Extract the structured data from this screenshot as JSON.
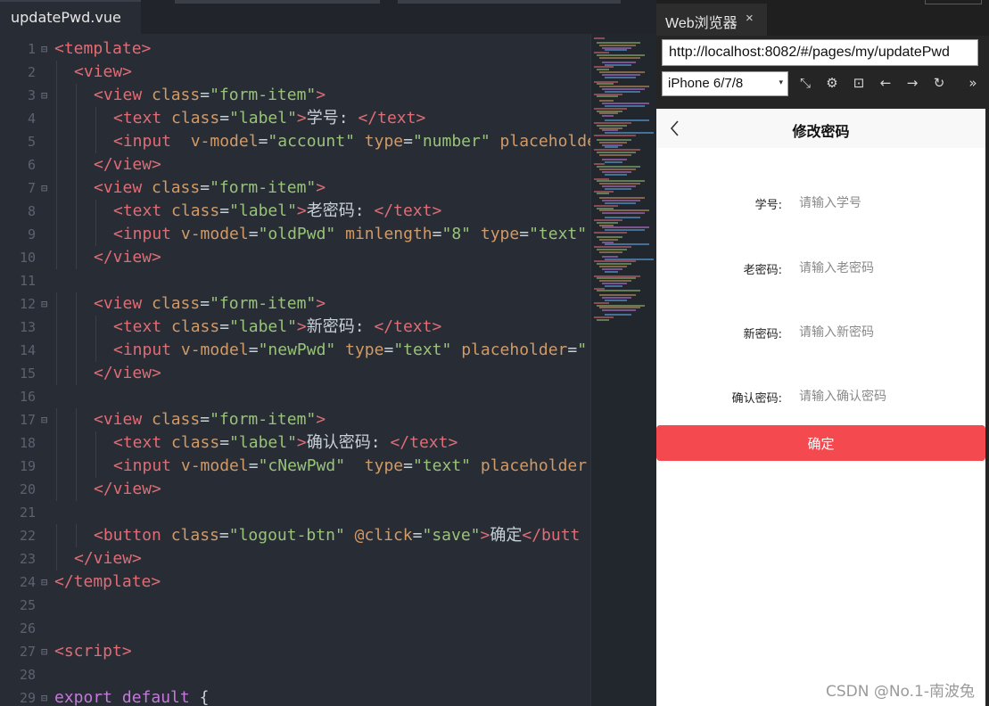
{
  "editor": {
    "tab_title": "updatePwd.vue",
    "lines": [
      {
        "n": "1",
        "fold": "⊟",
        "indent": 0,
        "tokens": [
          [
            "t-tag",
            "<template>"
          ]
        ]
      },
      {
        "n": "2",
        "fold": "",
        "indent": 1,
        "tokens": [
          [
            "t-tag",
            "<view>"
          ]
        ]
      },
      {
        "n": "3",
        "fold": "⊟",
        "indent": 2,
        "tokens": [
          [
            "t-tag",
            "<view "
          ],
          [
            "t-attr",
            "class"
          ],
          [
            "t-text",
            "="
          ],
          [
            "t-str",
            "\"form-item\""
          ],
          [
            "t-tag",
            ">"
          ]
        ]
      },
      {
        "n": "4",
        "fold": "",
        "indent": 3,
        "tokens": [
          [
            "t-tag",
            "<text "
          ],
          [
            "t-attr",
            "class"
          ],
          [
            "t-text",
            "="
          ],
          [
            "t-str",
            "\"label\""
          ],
          [
            "t-tag",
            ">"
          ],
          [
            "t-text",
            "学号: "
          ],
          [
            "t-tag",
            "</text>"
          ]
        ]
      },
      {
        "n": "5",
        "fold": "",
        "indent": 3,
        "tokens": [
          [
            "t-tag",
            "<input  "
          ],
          [
            "t-attr",
            "v-model"
          ],
          [
            "t-text",
            "="
          ],
          [
            "t-str",
            "\"account\""
          ],
          [
            "t-text",
            " "
          ],
          [
            "t-attr",
            "type"
          ],
          [
            "t-text",
            "="
          ],
          [
            "t-str",
            "\"number\""
          ],
          [
            "t-text",
            " "
          ],
          [
            "t-attr",
            "placeholde"
          ]
        ]
      },
      {
        "n": "6",
        "fold": "",
        "indent": 2,
        "tokens": [
          [
            "t-tag",
            "</view>"
          ]
        ]
      },
      {
        "n": "7",
        "fold": "⊟",
        "indent": 2,
        "tokens": [
          [
            "t-tag",
            "<view "
          ],
          [
            "t-attr",
            "class"
          ],
          [
            "t-text",
            "="
          ],
          [
            "t-str",
            "\"form-item\""
          ],
          [
            "t-tag",
            ">"
          ]
        ]
      },
      {
        "n": "8",
        "fold": "",
        "indent": 3,
        "tokens": [
          [
            "t-tag",
            "<text "
          ],
          [
            "t-attr",
            "class"
          ],
          [
            "t-text",
            "="
          ],
          [
            "t-str",
            "\"label\""
          ],
          [
            "t-tag",
            ">"
          ],
          [
            "t-text",
            "老密码: "
          ],
          [
            "t-tag",
            "</text>"
          ]
        ]
      },
      {
        "n": "9",
        "fold": "",
        "indent": 3,
        "tokens": [
          [
            "t-tag",
            "<input "
          ],
          [
            "t-attr",
            "v-model"
          ],
          [
            "t-text",
            "="
          ],
          [
            "t-str",
            "\"oldPwd\""
          ],
          [
            "t-text",
            " "
          ],
          [
            "t-attr",
            "minlength"
          ],
          [
            "t-text",
            "="
          ],
          [
            "t-str",
            "\"8\""
          ],
          [
            "t-text",
            " "
          ],
          [
            "t-attr",
            "type"
          ],
          [
            "t-text",
            "="
          ],
          [
            "t-str",
            "\"text\""
          ]
        ]
      },
      {
        "n": "10",
        "fold": "",
        "indent": 2,
        "tokens": [
          [
            "t-tag",
            "</view>"
          ]
        ]
      },
      {
        "n": "11",
        "fold": "",
        "indent": 0,
        "tokens": []
      },
      {
        "n": "12",
        "fold": "⊟",
        "indent": 2,
        "tokens": [
          [
            "t-tag",
            "<view "
          ],
          [
            "t-attr",
            "class"
          ],
          [
            "t-text",
            "="
          ],
          [
            "t-str",
            "\"form-item\""
          ],
          [
            "t-tag",
            ">"
          ]
        ]
      },
      {
        "n": "13",
        "fold": "",
        "indent": 3,
        "tokens": [
          [
            "t-tag",
            "<text "
          ],
          [
            "t-attr",
            "class"
          ],
          [
            "t-text",
            "="
          ],
          [
            "t-str",
            "\"label\""
          ],
          [
            "t-tag",
            ">"
          ],
          [
            "t-text",
            "新密码: "
          ],
          [
            "t-tag",
            "</text>"
          ]
        ]
      },
      {
        "n": "14",
        "fold": "",
        "indent": 3,
        "tokens": [
          [
            "t-tag",
            "<input "
          ],
          [
            "t-attr",
            "v-model"
          ],
          [
            "t-text",
            "="
          ],
          [
            "t-str",
            "\"newPwd\""
          ],
          [
            "t-text",
            " "
          ],
          [
            "t-attr",
            "type"
          ],
          [
            "t-text",
            "="
          ],
          [
            "t-str",
            "\"text\""
          ],
          [
            "t-text",
            " "
          ],
          [
            "t-attr",
            "placeholder"
          ],
          [
            "t-text",
            "="
          ],
          [
            "t-str",
            "\""
          ]
        ]
      },
      {
        "n": "15",
        "fold": "",
        "indent": 2,
        "tokens": [
          [
            "t-tag",
            "</view>"
          ]
        ]
      },
      {
        "n": "16",
        "fold": "",
        "indent": 0,
        "tokens": []
      },
      {
        "n": "17",
        "fold": "⊟",
        "indent": 2,
        "tokens": [
          [
            "t-tag",
            "<view "
          ],
          [
            "t-attr",
            "class"
          ],
          [
            "t-text",
            "="
          ],
          [
            "t-str",
            "\"form-item\""
          ],
          [
            "t-tag",
            ">"
          ]
        ]
      },
      {
        "n": "18",
        "fold": "",
        "indent": 3,
        "tokens": [
          [
            "t-tag",
            "<text "
          ],
          [
            "t-attr",
            "class"
          ],
          [
            "t-text",
            "="
          ],
          [
            "t-str",
            "\"label\""
          ],
          [
            "t-tag",
            ">"
          ],
          [
            "t-text",
            "确认密码: "
          ],
          [
            "t-tag",
            "</text>"
          ]
        ]
      },
      {
        "n": "19",
        "fold": "",
        "indent": 3,
        "tokens": [
          [
            "t-tag",
            "<input "
          ],
          [
            "t-attr",
            "v-model"
          ],
          [
            "t-text",
            "="
          ],
          [
            "t-str",
            "\"cNewPwd\""
          ],
          [
            "t-text",
            "  "
          ],
          [
            "t-attr",
            "type"
          ],
          [
            "t-text",
            "="
          ],
          [
            "t-str",
            "\"text\""
          ],
          [
            "t-text",
            " "
          ],
          [
            "t-attr",
            "placeholder"
          ]
        ]
      },
      {
        "n": "20",
        "fold": "",
        "indent": 2,
        "tokens": [
          [
            "t-tag",
            "</view>"
          ]
        ]
      },
      {
        "n": "21",
        "fold": "",
        "indent": 0,
        "tokens": []
      },
      {
        "n": "22",
        "fold": "",
        "indent": 2,
        "tokens": [
          [
            "t-tag",
            "<button "
          ],
          [
            "t-attr",
            "class"
          ],
          [
            "t-text",
            "="
          ],
          [
            "t-str",
            "\"logout-btn\""
          ],
          [
            "t-text",
            " "
          ],
          [
            "t-attr",
            "@click"
          ],
          [
            "t-text",
            "="
          ],
          [
            "t-str",
            "\"save\""
          ],
          [
            "t-tag",
            ">"
          ],
          [
            "t-text",
            "确定"
          ],
          [
            "t-tag",
            "</butt"
          ]
        ]
      },
      {
        "n": "23",
        "fold": "",
        "indent": 1,
        "tokens": [
          [
            "t-tag",
            "</view>"
          ]
        ]
      },
      {
        "n": "24",
        "fold": "⊟",
        "indent": 0,
        "tokens": [
          [
            "t-tag",
            "</template>"
          ]
        ]
      },
      {
        "n": "25",
        "fold": "",
        "indent": 0,
        "tokens": []
      },
      {
        "n": "26",
        "fold": "",
        "indent": 0,
        "tokens": []
      },
      {
        "n": "27",
        "fold": "⊟",
        "indent": 0,
        "tokens": [
          [
            "t-tag",
            "<script>"
          ]
        ]
      },
      {
        "n": "28",
        "fold": "",
        "indent": 0,
        "tokens": []
      },
      {
        "n": "29",
        "fold": "⊟",
        "indent": 0,
        "tokens": [
          [
            "t-kw",
            "export"
          ],
          [
            "t-text",
            " "
          ],
          [
            "t-kw",
            "default"
          ],
          [
            "t-text",
            " {"
          ]
        ]
      }
    ]
  },
  "browser": {
    "tab_label": "Web浏览器",
    "tab_close": "×",
    "url": "http://localhost:8082/#/pages/my/updatePwd",
    "device": "iPhone 6/7/8",
    "device_caret": "▾",
    "toolbar_icons": [
      "rotate-icon",
      "settings-icon",
      "console-icon",
      "arrow-left-icon",
      "arrow-right-icon",
      "refresh-icon",
      "more-icon"
    ],
    "toolbar_glyphs": [
      "⤡",
      "⚙",
      "⊡",
      "←",
      "→",
      "↻",
      "»"
    ]
  },
  "app": {
    "nav_title": "修改密码",
    "back_glyph": "<",
    "form": [
      {
        "label": "学号:",
        "placeholder": "请输入学号"
      },
      {
        "label": "老密码:",
        "placeholder": "请输入老密码"
      },
      {
        "label": "新密码:",
        "placeholder": "请输入新密码"
      },
      {
        "label": "确认密码:",
        "placeholder": "请输入确认密码"
      }
    ],
    "button_label": "确定",
    "watermark": "CSDN @No.1-南波兔",
    "accent": "#f44a4f"
  }
}
